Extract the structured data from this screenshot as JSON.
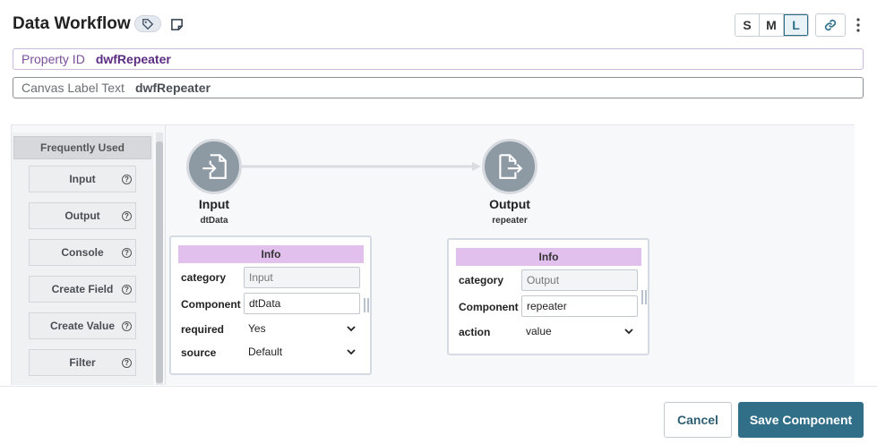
{
  "header": {
    "title": "Data Workflow",
    "tag_icon": "tag-icon",
    "note_icon": "note-icon",
    "sizes": [
      "S",
      "M",
      "L"
    ],
    "active_size": "L",
    "link_icon": "link-icon",
    "more_icon": "kebab-menu-icon"
  },
  "property_id": {
    "label": "Property ID",
    "value": "dwfRepeater"
  },
  "canvas_label": {
    "label": "Canvas Label Text",
    "value": "dwfRepeater"
  },
  "palette": {
    "heading": "Frequently Used",
    "items": [
      {
        "label": "Input"
      },
      {
        "label": "Output"
      },
      {
        "label": "Console"
      },
      {
        "label": "Create Field"
      },
      {
        "label": "Create Value"
      },
      {
        "label": "Filter"
      }
    ],
    "help_glyph": "?"
  },
  "nodes": {
    "input": {
      "title": "Input",
      "subtitle": "dtData",
      "icon": "file-import-icon",
      "info": {
        "heading": "Info",
        "rows": [
          {
            "label": "category",
            "value": "Input",
            "kind": "readonly"
          },
          {
            "label": "Component",
            "value": "dtData",
            "kind": "text"
          },
          {
            "label": "required",
            "value": "Yes",
            "kind": "select"
          },
          {
            "label": "source",
            "value": "Default",
            "kind": "select"
          }
        ]
      }
    },
    "output": {
      "title": "Output",
      "subtitle": "repeater",
      "icon": "file-export-icon",
      "info": {
        "heading": "Info",
        "rows": [
          {
            "label": "category",
            "value": "Output",
            "kind": "readonly"
          },
          {
            "label": "Component",
            "value": "repeater",
            "kind": "text"
          },
          {
            "label": "action",
            "value": "value",
            "kind": "select"
          }
        ]
      }
    }
  },
  "footer": {
    "cancel_label": "Cancel",
    "save_label": "Save Component"
  },
  "colors": {
    "accent": "#316f88",
    "info_header": "#e1c0ee",
    "node_fill": "#8d99a3",
    "property_id_value": "#5b2d82"
  }
}
